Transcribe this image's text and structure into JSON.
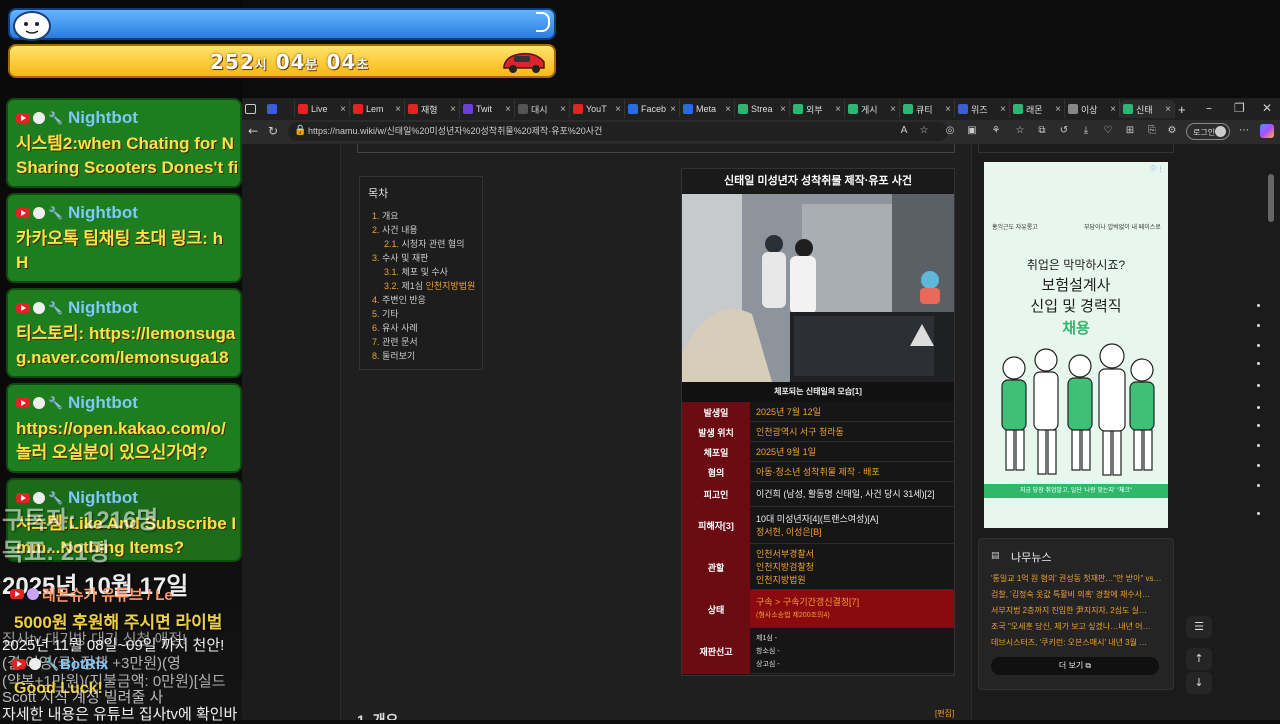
{
  "overlay": {
    "timer": {
      "h": "252",
      "h_unit": "시",
      "m": "04",
      "m_unit": "분",
      "s": "04",
      "s_unit": "초"
    },
    "chats": [
      {
        "name": "Nightbot",
        "msg": "시스템2:when Chating for N\nSharing Scooters Dones't fi"
      },
      {
        "name": "Nightbot",
        "msg": "카카오톡 팀채팅 초대 링크: h\nH"
      },
      {
        "name": "Nightbot",
        "msg": "티스토리: https://lemonsuga\ng.naver.com/lemonsuga18"
      },
      {
        "name": "Nightbot",
        "msg": "https://open.kakao.com/o/\n놀러 오실분이 있으신가여?"
      },
      {
        "name": "Nightbot",
        "msg": "시스템:Like And Subscribe I\nmm...Nothing Items?"
      }
    ],
    "ghost": {
      "subscribers": "구독자: 1216명",
      "goal": "목표: 21명",
      "date": "2025년 10월 17일",
      "channel": "래몬슈가 유튜브 / Le",
      "donation": "5000원 후원해 주시면 라이벌",
      "notice1": "집사tv 대기방 대기 신청 애정!",
      "notice2": "2025년 11월 08일~09일 까지 천안!",
      "notice3": "(결    이영(국) 정책 +3만원)(영",
      "notice4": "(약복+1만원)(지불금액: 0만원)[실드",
      "notice5": "Scott    지직 계정 빌려줄 사",
      "notice6": "자세한 내용은 유튜브 집사tv에 확인바",
      "botrix": "BotRix",
      "good_luck": "Good Luck!"
    }
  },
  "browser": {
    "tabs": [
      {
        "label": "",
        "color": "#3b5ed6"
      },
      {
        "label": "Live",
        "color": "#e42222"
      },
      {
        "label": "Lem",
        "color": "#e42222"
      },
      {
        "label": "재형",
        "color": "#e42222"
      },
      {
        "label": "Twit",
        "color": "#6b3fd6"
      },
      {
        "label": "대시",
        "color": "#555555"
      },
      {
        "label": "YouT",
        "color": "#e42222"
      },
      {
        "label": "Faceb",
        "color": "#2a6be0"
      },
      {
        "label": "Meta",
        "color": "#2a6be0"
      },
      {
        "label": "Strea",
        "color": "#2bb673"
      },
      {
        "label": "외부",
        "color": "#2bb673"
      },
      {
        "label": "게시",
        "color": "#2bb673"
      },
      {
        "label": "큐티",
        "color": "#2bb673"
      },
      {
        "label": "위즈",
        "color": "#3b5ed6"
      },
      {
        "label": "래몬",
        "color": "#2bb673"
      },
      {
        "label": "이상",
        "color": "#888888"
      },
      {
        "label": "신태",
        "color": "#2bb673"
      }
    ],
    "url": "https://namu.wiki/w/신태일%20미성년자%20성착취물%20제작·유포%20사건",
    "login_label": "로그인"
  },
  "toc": {
    "title": "목차",
    "items": [
      {
        "num": "1.",
        "text": "개요",
        "link": ""
      },
      {
        "num": "2.",
        "text": "사건 내용",
        "link": ""
      },
      {
        "num": "2.1.",
        "text": "시청자 관련 혐의",
        "link": ""
      },
      {
        "num": "3.",
        "text": "수사 및 재판",
        "link": ""
      },
      {
        "num": "3.1.",
        "text": "체포 및 수사",
        "link": ""
      },
      {
        "num": "3.2.",
        "text": "제1심 ",
        "link": "인천지방법원"
      },
      {
        "num": "4.",
        "text": "주변인 반응",
        "link": ""
      },
      {
        "num": "5.",
        "text": "기타",
        "link": ""
      },
      {
        "num": "6.",
        "text": "유사 사례",
        "link": ""
      },
      {
        "num": "7.",
        "text": "관련 문서",
        "link": ""
      },
      {
        "num": "8.",
        "text": "둘러보기",
        "link": ""
      }
    ]
  },
  "infobox": {
    "title": "신태일 미성년자 성착취물 제작·유포 사건",
    "caption": "체포되는 신태일의 모습[1]",
    "rows": [
      {
        "label": "발생일",
        "lines": [
          "2025년 7월 12일"
        ]
      },
      {
        "label": "발생 위치",
        "lines": [
          "인천광역시 서구 청라동"
        ]
      },
      {
        "label": "체포일",
        "lines": [
          "2025년 9월 1일"
        ]
      },
      {
        "label": "혐의",
        "lines": [
          "아동·청소년 성착취물 제작 · 배포"
        ]
      },
      {
        "label": "피고인",
        "lines": [
          "이건희 (남성, 활동명 신태일, 사건 당시 31세)[2]"
        ]
      },
      {
        "label": "피해자[3]",
        "lines": [
          "10대 미성년자[4](트랜스여성)[A]",
          "정서현, 이성은[B]"
        ]
      },
      {
        "label": "관할",
        "lines": [
          "인천서부경찰서",
          "인천지방검찰청",
          "인천지방법원"
        ]
      },
      {
        "label": "상태",
        "lines": [
          "구속 > 구속기간갱신결정[7]",
          "(형사소송법 제200조의4)"
        ]
      },
      {
        "label": "재판선고",
        "lines": [
          "제1심 -",
          "항소심 -",
          "상고심 -"
        ]
      }
    ]
  },
  "section": {
    "heading": "1. 개요",
    "edit": "[편집]"
  },
  "ad": {
    "top_left": "홍익근도 자유롱고",
    "top_right": "부담이나 압박없이 내 페이스로",
    "headline1": "취업은 막막하시죠?",
    "headline2": "보험설계사",
    "headline3": "신입 및 경력직",
    "highlight": "채용",
    "banner": "지금 당장 취업말고, 일단 '나랑 맞는지' \"체크\""
  },
  "news": {
    "title": "나무뉴스",
    "items": [
      "'통일교 1억 원 혐의' 권성동 첫재판…\"안 받아\" vs…",
      "검찰, '김정숙 옷값 특활비 의혹' 경찰에 재수사…",
      "서부지법 2층까지 진입한 尹지지자, 2심도 실…",
      "조국 \"오세훈 당신, 제가 보고 싶겠나…내년 어…",
      "데브시스터즈, '쿠키런: 오븐스매시' 내년 3월 …"
    ],
    "more": "더 보기"
  },
  "colors": {
    "accent": "#f0a030",
    "infobox_label": "#6b0b12",
    "status_bg": "#8b0a10",
    "chat_card": "#1e7d1e"
  }
}
